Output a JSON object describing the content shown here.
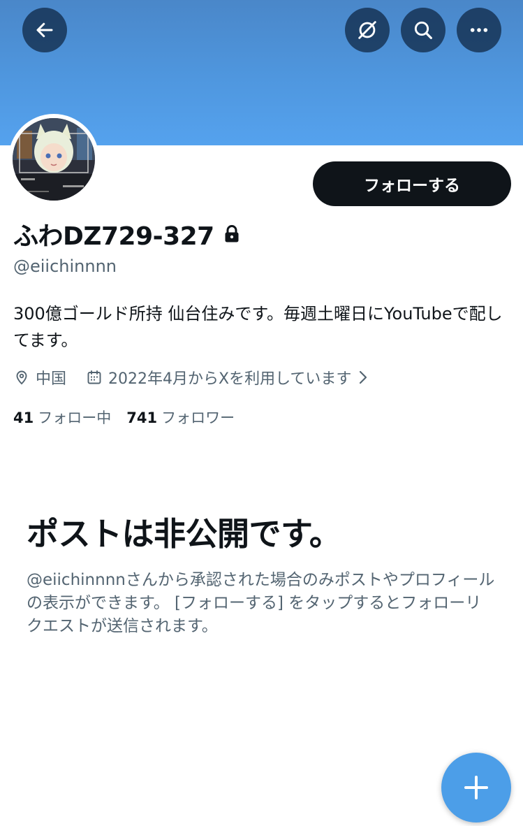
{
  "header": {
    "back_icon": "arrow-left-icon",
    "hide_icon": "eye-slash-icon",
    "search_icon": "search-icon",
    "more_icon": "more-dots-icon",
    "banner_color": "#4f97df"
  },
  "profile": {
    "display_name": "ふわDZ729-327",
    "protected_icon": "lock-icon",
    "handle": "@eiichinnnn",
    "bio": "300億ゴールド所持 仙台住みです。毎週土曜日にYouTubeで配してます。",
    "location": "中国",
    "joined": "2022年4月からXを利用しています",
    "follow_label": "フォローする"
  },
  "stats": {
    "following_count": "41",
    "following_label": "フォロー中",
    "followers_count": "741",
    "followers_label": "フォロワー"
  },
  "private_notice": {
    "title": "ポストは非公開です。",
    "description": "@eiichinnnnさんから承認された場合のみポストやプロフィールの表示ができます。 [フォローする] をタップするとフォローリクエストが送信されます。"
  },
  "fab": {
    "icon": "plus-icon",
    "color": "#4c9ee8"
  }
}
